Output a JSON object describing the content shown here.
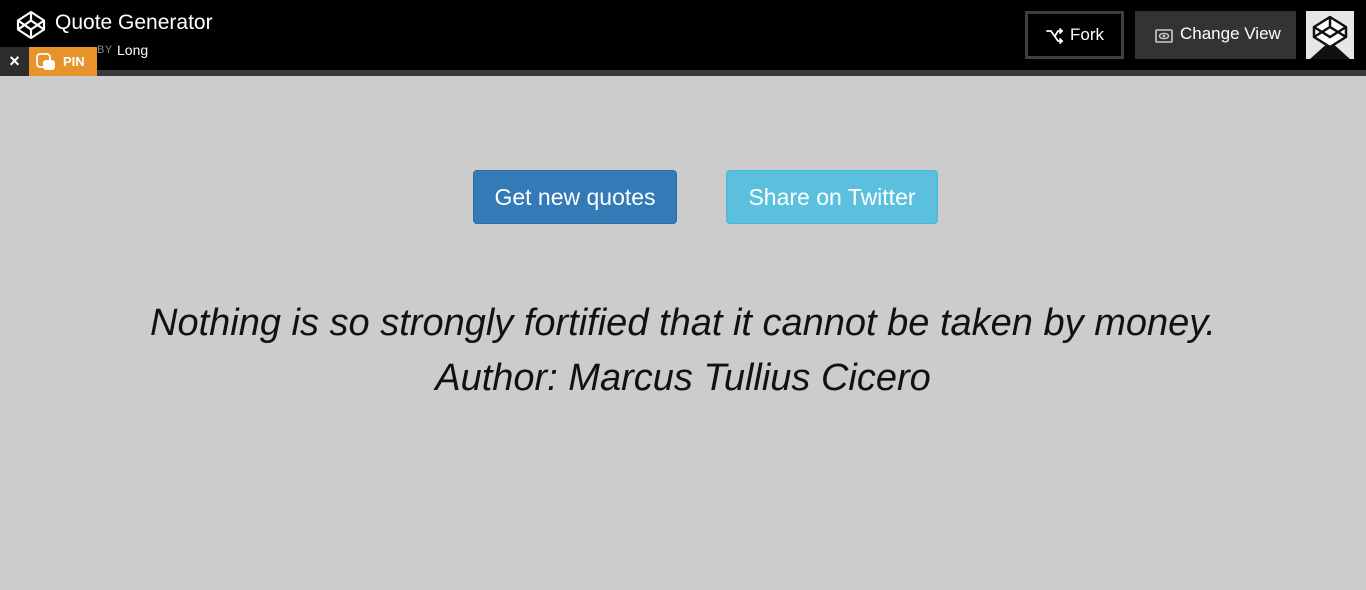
{
  "header": {
    "title": "Quote Generator",
    "byline": "BY",
    "author": "Long",
    "logo_icon": "codepen-logo-icon",
    "close_label": "×",
    "pin_label": "PIN",
    "pin_icon": "pin-icon",
    "fork_label": "Fork",
    "fork_icon": "fork-icon",
    "change_view_label": "Change View",
    "change_view_icon": "eye-icon",
    "avatar_icon": "codepen-avatar-icon"
  },
  "main": {
    "new_quote_label": "Get new quotes",
    "share_label": "Share on Twitter",
    "quote_text": "Nothing is so strongly fortified that it cannot be taken by money.",
    "quote_author": "Author: Marcus Tullius Cicero"
  },
  "colors": {
    "topbar": "#000000",
    "page_background": "#cccccc",
    "pin_accent": "#e8922b",
    "primary_button": "#337ab7",
    "info_button": "#5bc0de"
  }
}
